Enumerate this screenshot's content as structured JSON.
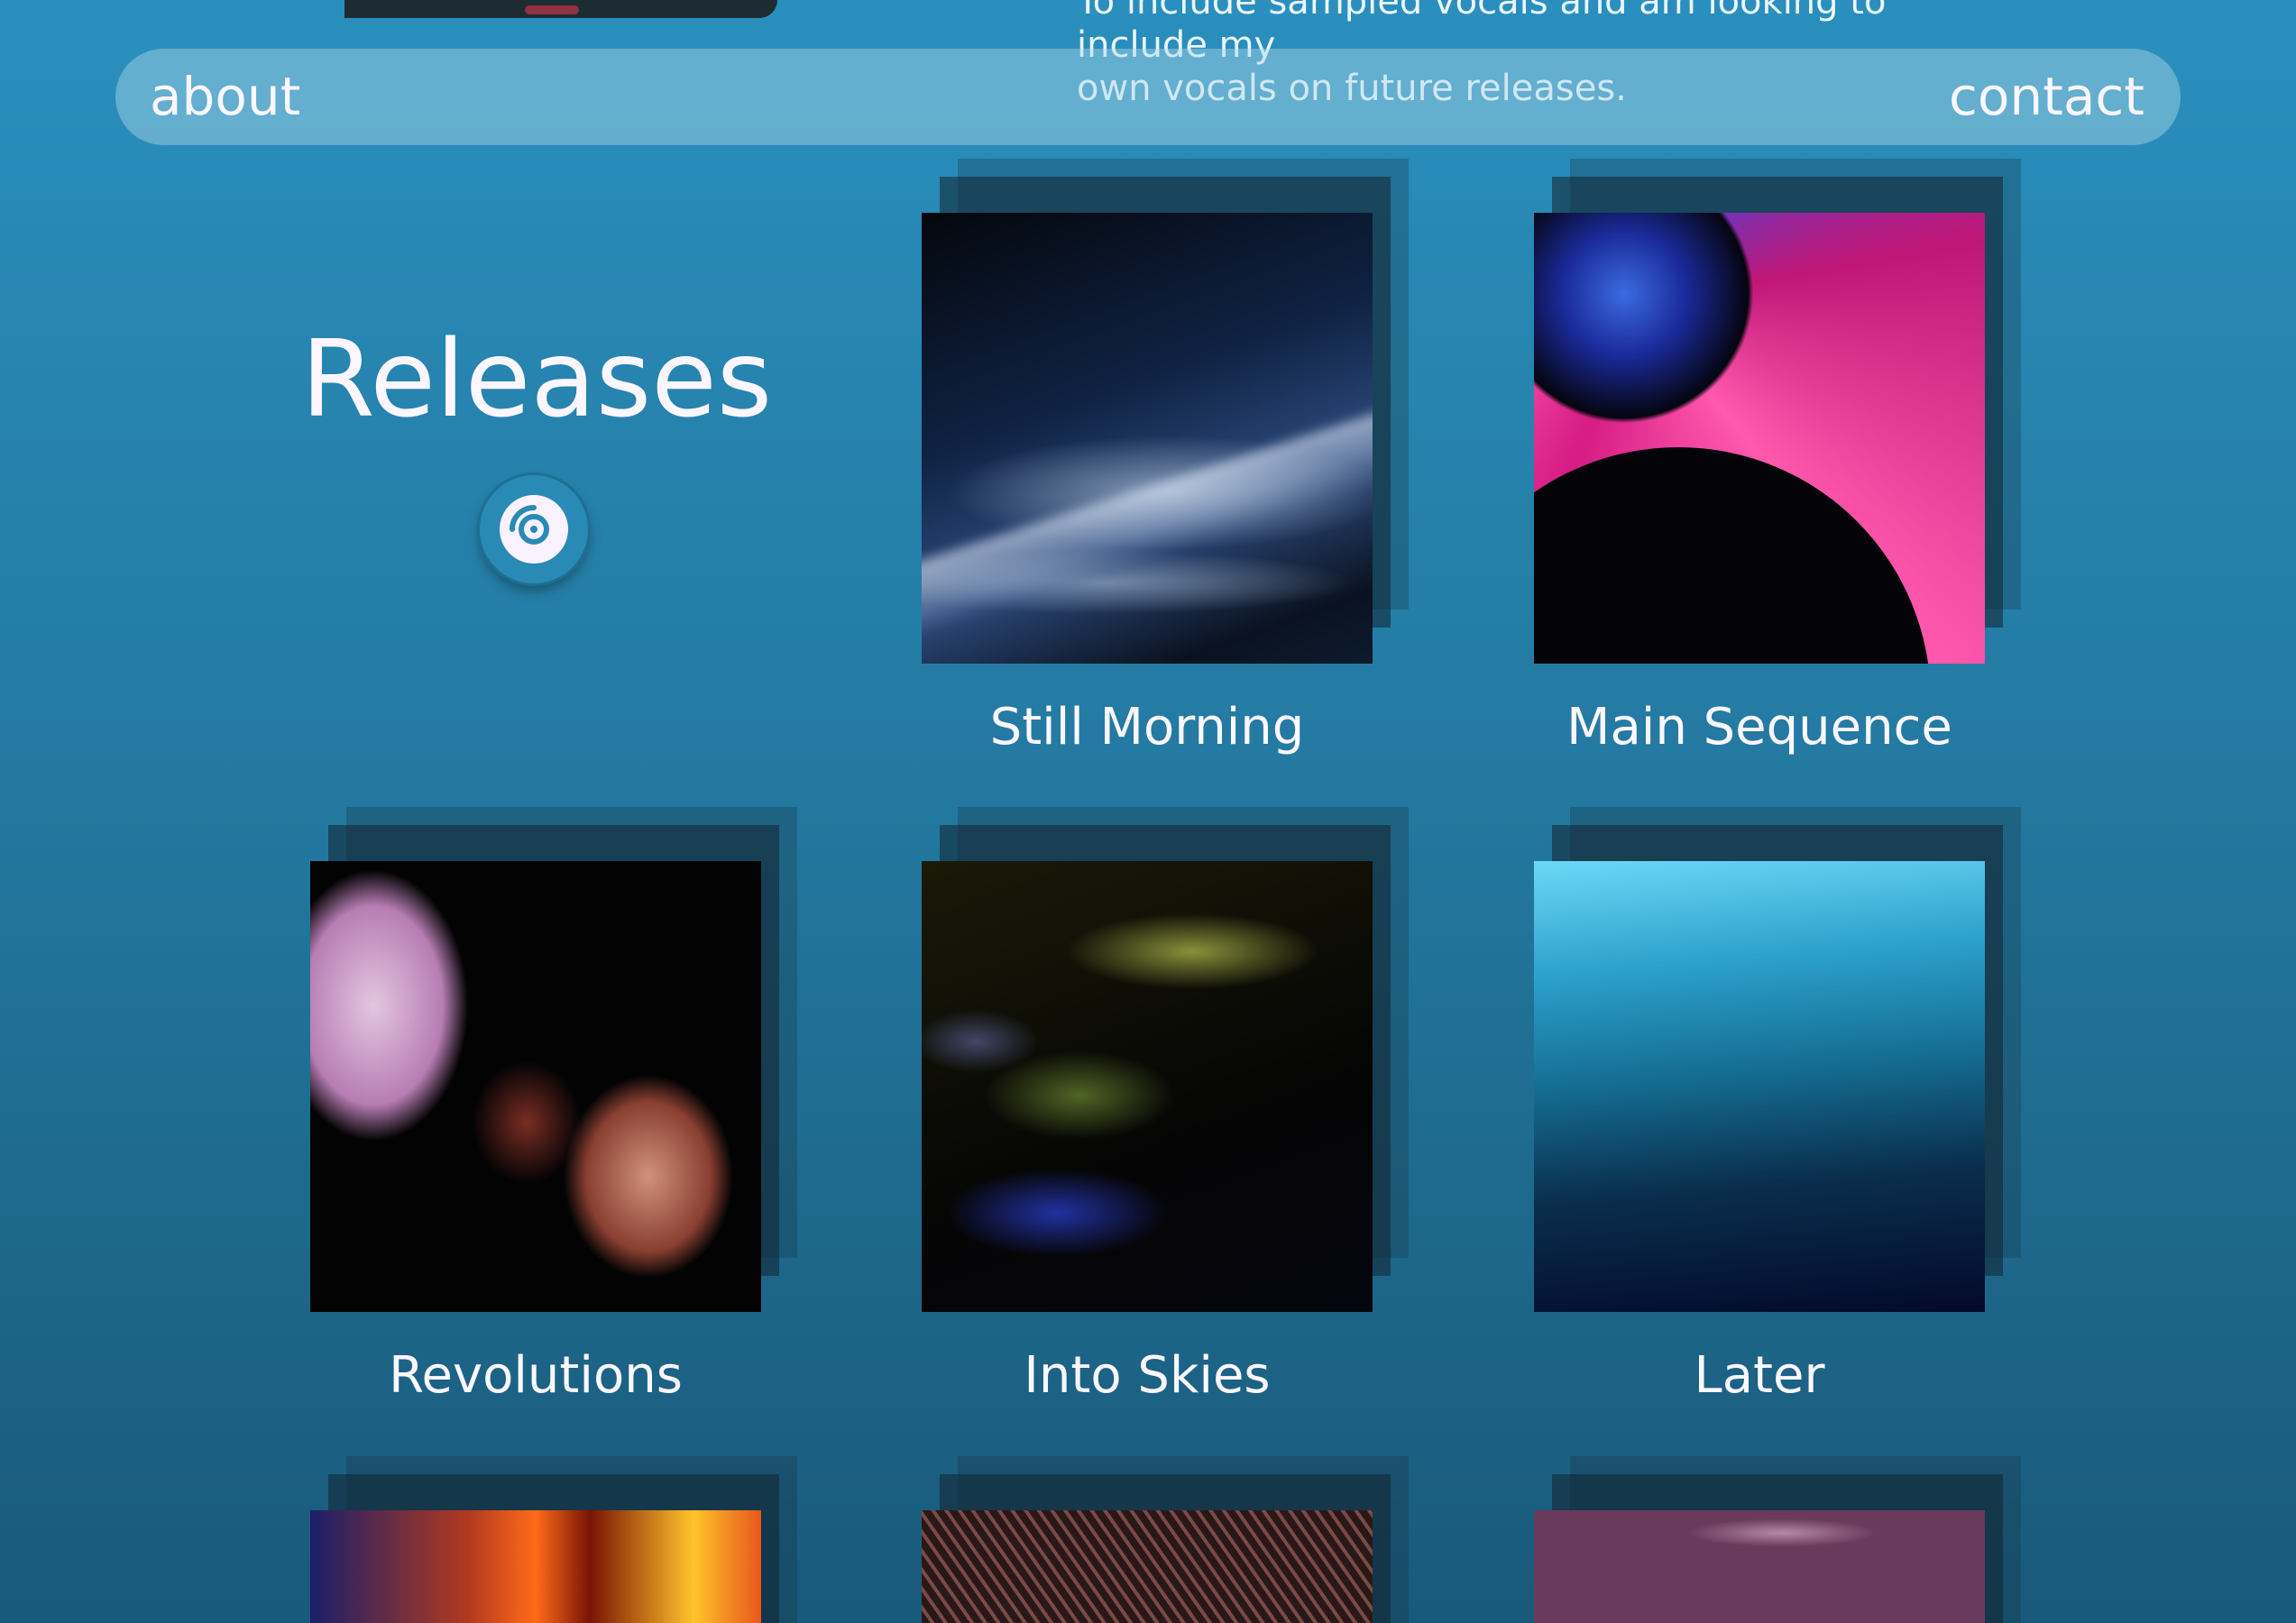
{
  "top_text": {
    "line1": "To include sampled vocals and am looking to include my",
    "line2": "own vocals on future releases."
  },
  "nav": {
    "about": "about",
    "contact": "contact"
  },
  "releases": {
    "title": "Releases",
    "icon": "disc-icon",
    "items": [
      {
        "title": "Still Morning"
      },
      {
        "title": "Main Sequence"
      },
      {
        "title": "Revolutions"
      },
      {
        "title": "Into Skies"
      },
      {
        "title": "Later"
      },
      {
        "title": ""
      },
      {
        "title": ""
      },
      {
        "title": ""
      }
    ]
  },
  "colors": {
    "background_top": "#2a8fbe",
    "background_bottom": "#19597a",
    "nav_bar": "#7fb9d3",
    "text": "#f6f2fb"
  }
}
